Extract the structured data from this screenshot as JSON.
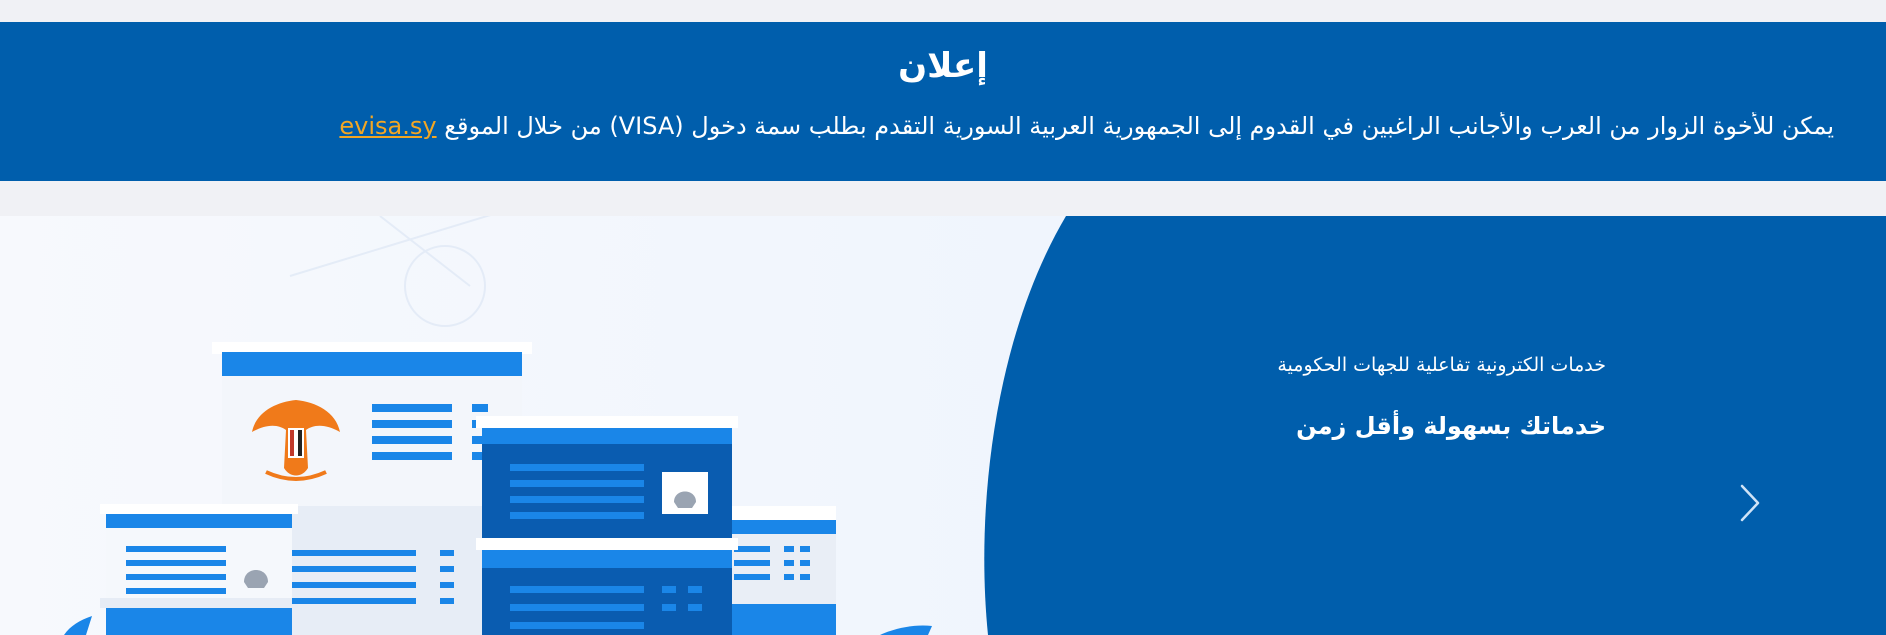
{
  "announcement": {
    "title": "إعلان",
    "text": "يمكن للأخوة الزوار من العرب والأجانب الراغبين في القدوم إلى الجمهورية العربية السورية التقدم بطلب سمة دخول (VISA) من خلال الموقع",
    "link_text": "evisa.sy"
  },
  "hero": {
    "tagline": "خدمات الكترونية تفاعلية للجهات الحكومية",
    "headline": "خدماتك بسهولة وأقل زمن"
  },
  "colors": {
    "primary": "#005eac",
    "accent_link": "#f2a623",
    "building_blue": "#1a86e8",
    "emblem_orange": "#f07a1a"
  },
  "icons": {
    "next": "chevron-right-icon",
    "emblem": "eagle-emblem-icon"
  }
}
